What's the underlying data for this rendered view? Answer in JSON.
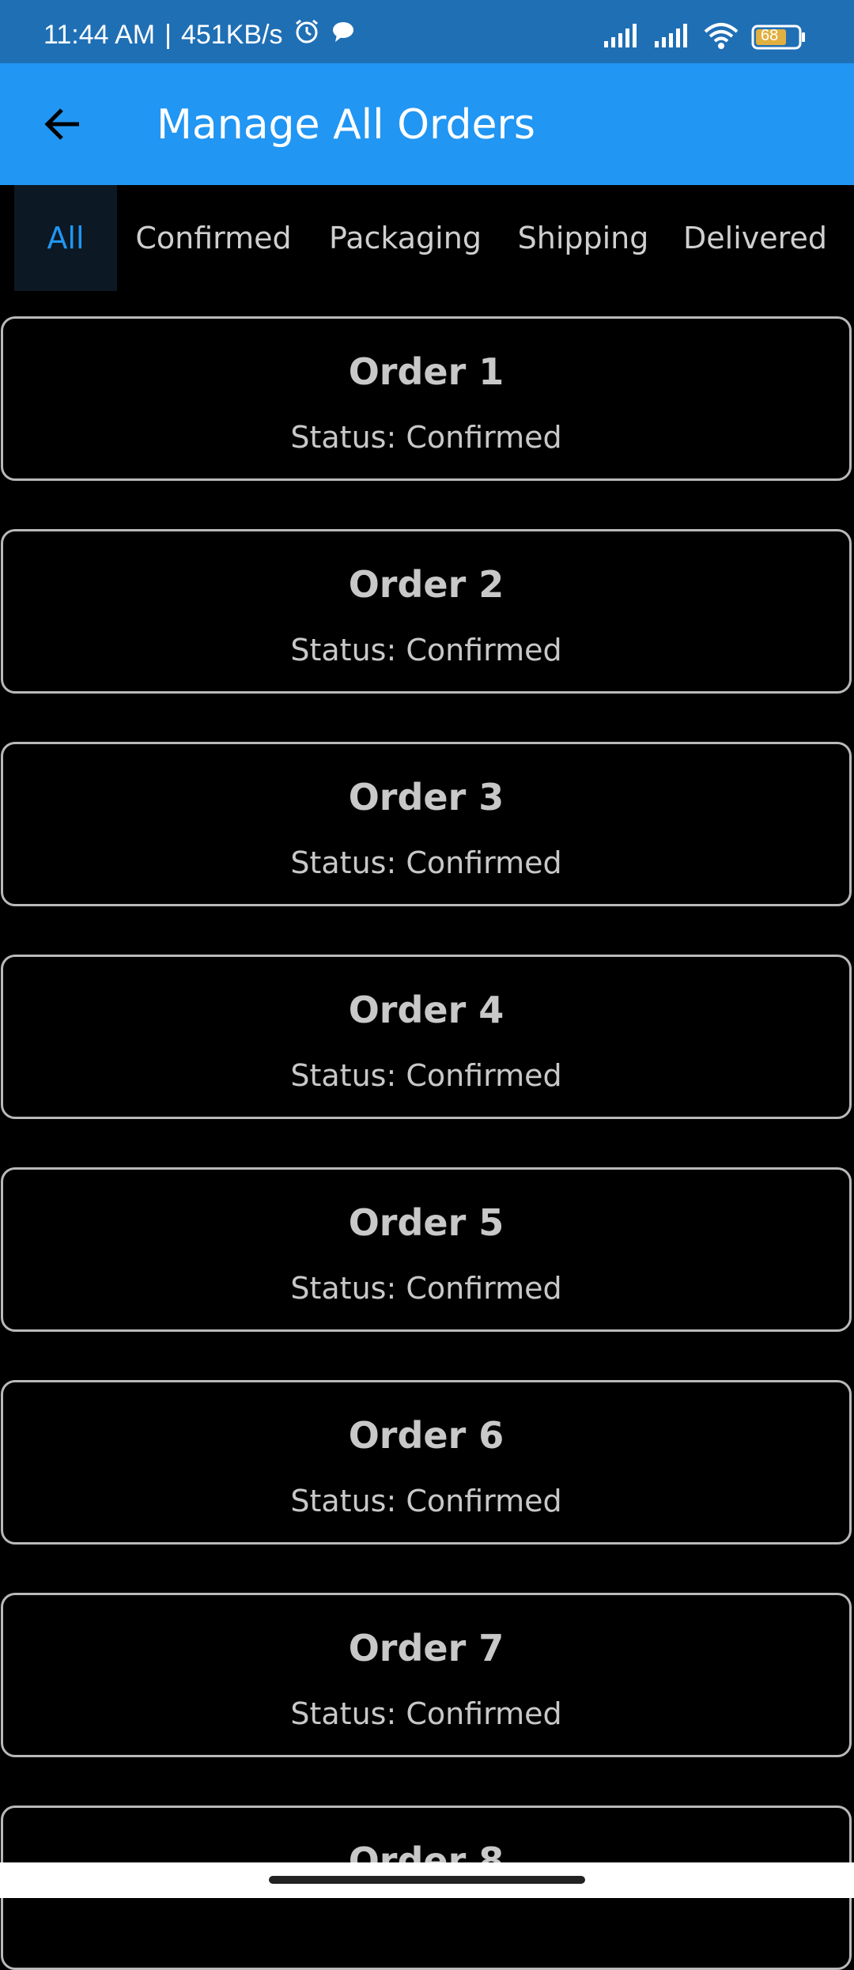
{
  "status_bar": {
    "time": "11:44 AM",
    "separator": "|",
    "network_speed": "451KB/s",
    "battery_level": "68",
    "icons": [
      "alarm-icon",
      "chat-bubble-icon",
      "signal-icon",
      "signal-icon",
      "wifi-icon",
      "battery-icon"
    ]
  },
  "app_bar": {
    "title": "Manage All Orders",
    "back_icon": "arrow-back-icon"
  },
  "tabs": [
    {
      "label": "All",
      "active": true
    },
    {
      "label": "Confirmed",
      "active": false
    },
    {
      "label": "Packaging",
      "active": false
    },
    {
      "label": "Shipping",
      "active": false
    },
    {
      "label": "Delivered",
      "active": false
    }
  ],
  "orders": [
    {
      "name": "Order 1",
      "status": "Status: Confirmed"
    },
    {
      "name": "Order 2",
      "status": "Status: Confirmed"
    },
    {
      "name": "Order 3",
      "status": "Status: Confirmed"
    },
    {
      "name": "Order 4",
      "status": "Status: Confirmed"
    },
    {
      "name": "Order 5",
      "status": "Status: Confirmed"
    },
    {
      "name": "Order 6",
      "status": "Status: Confirmed"
    },
    {
      "name": "Order 7",
      "status": "Status: Confirmed"
    },
    {
      "name": "Order 8",
      "status": ""
    }
  ],
  "colors": {
    "status_bar": "#1f6fb5",
    "app_bar": "#2196f3",
    "active_tab": "#2196f3",
    "card_border": "#b9b9b9",
    "background": "#000000"
  }
}
